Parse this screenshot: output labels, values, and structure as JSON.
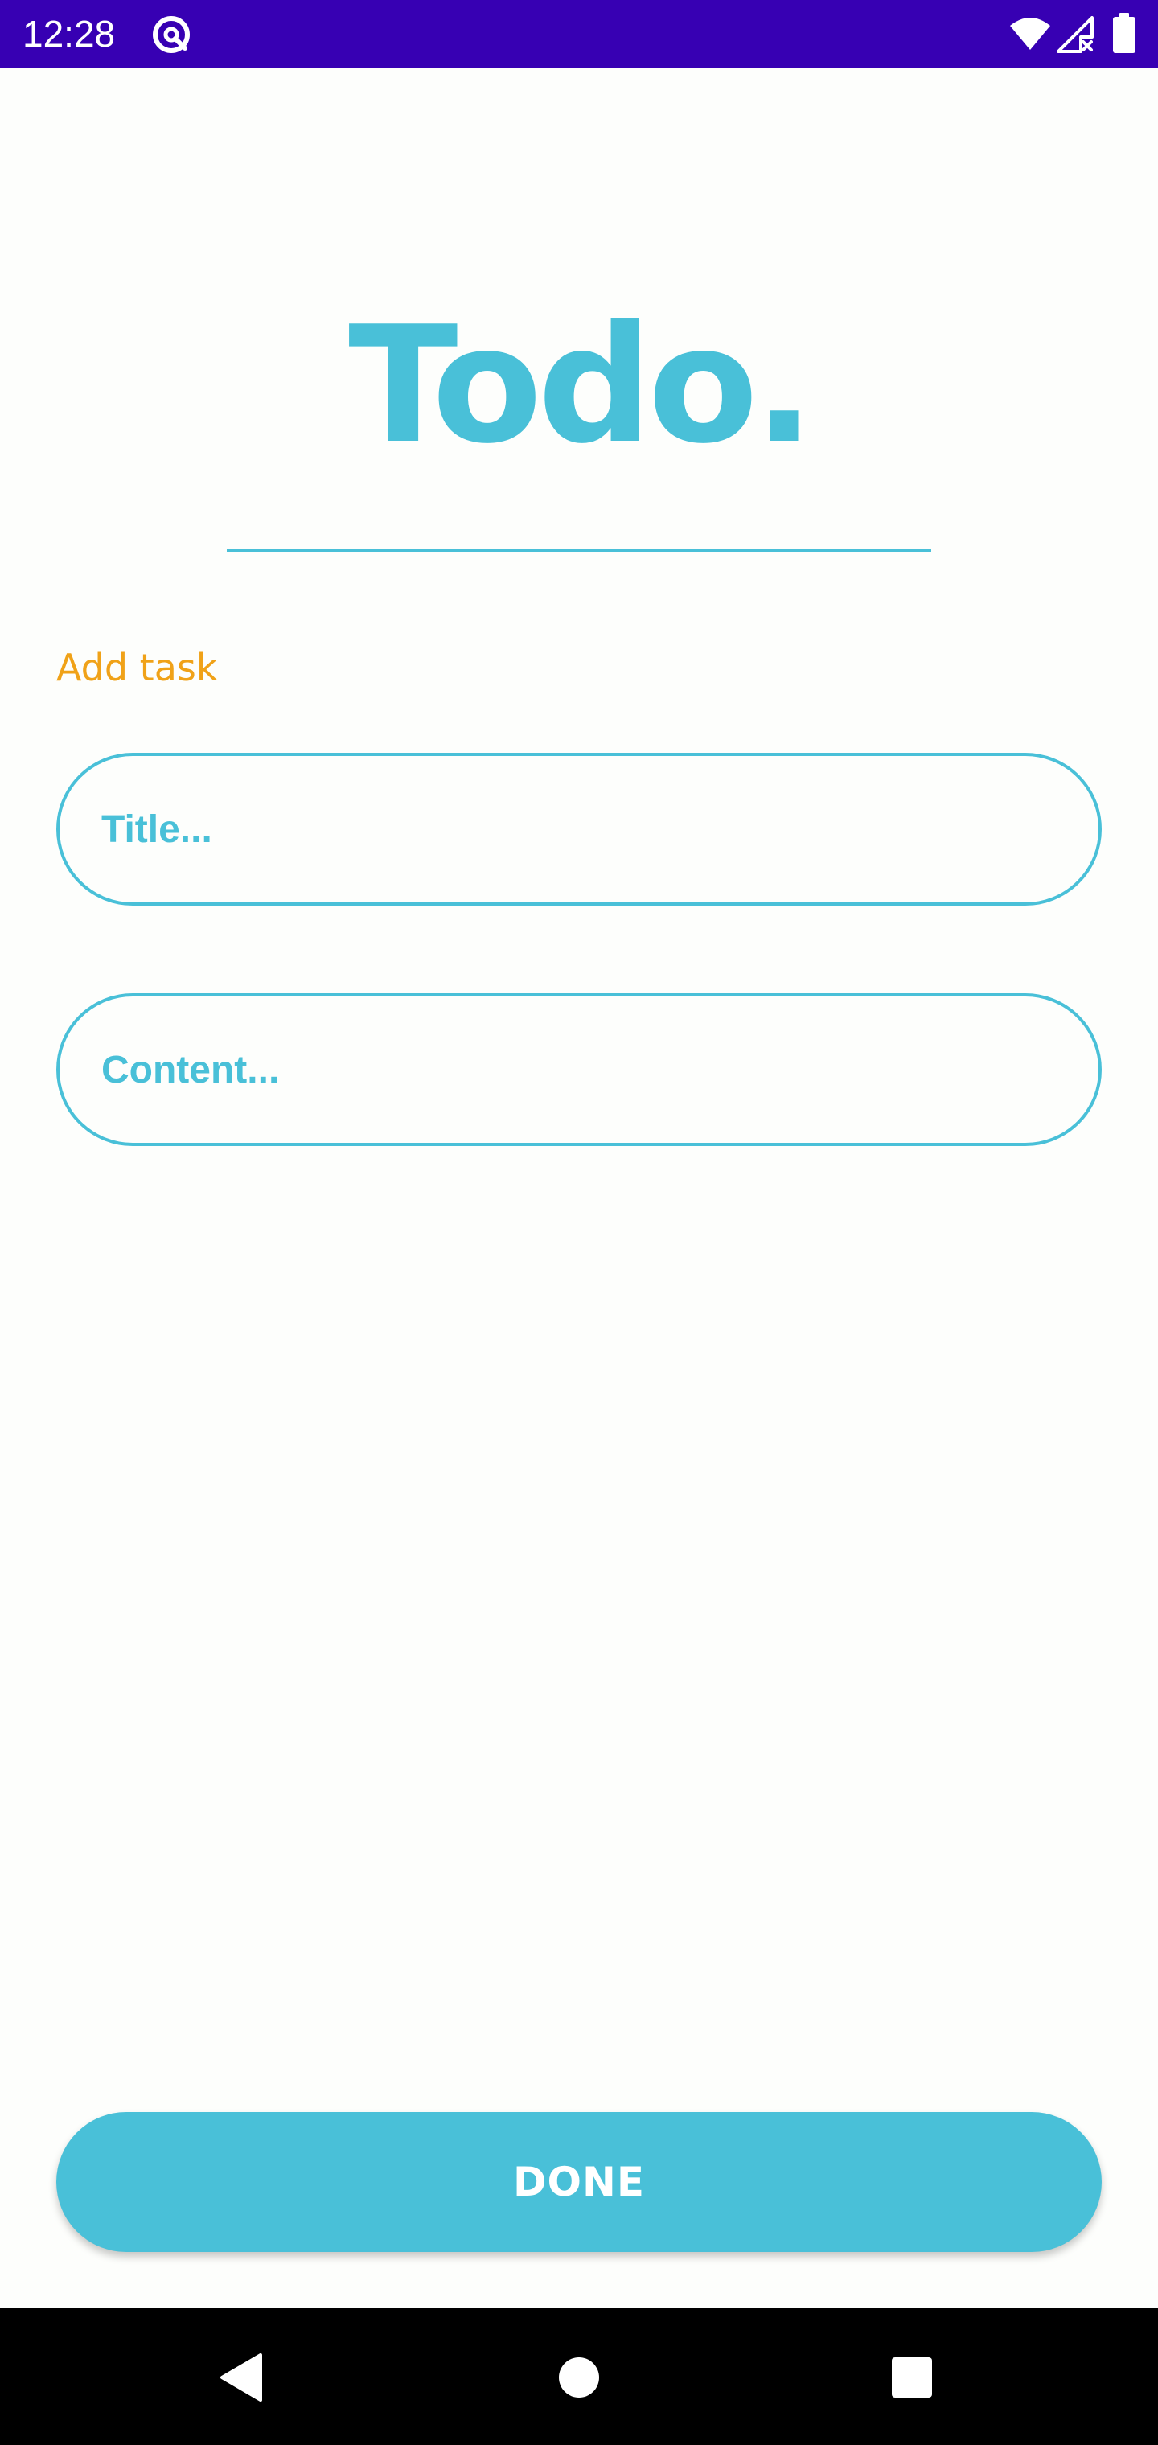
{
  "status_bar": {
    "time": "12:28",
    "app_icon": "at-sign-icon",
    "icons": [
      "wifi-icon",
      "cell-signal-no-data-icon",
      "battery-icon"
    ],
    "background_color": "#3700b3"
  },
  "header": {
    "title": "Todo."
  },
  "form": {
    "section_label": "Add task",
    "title_placeholder": "Title...",
    "title_value": "",
    "content_placeholder": "Content...",
    "content_value": ""
  },
  "actions": {
    "done_label": "DONE"
  },
  "nav_bar": {
    "icons": [
      "back-icon",
      "home-icon",
      "recents-icon"
    ]
  },
  "colors": {
    "accent": "#49c0d8",
    "label": "#f0a218",
    "background": "#fdfefc",
    "status_bar": "#3700b3"
  }
}
